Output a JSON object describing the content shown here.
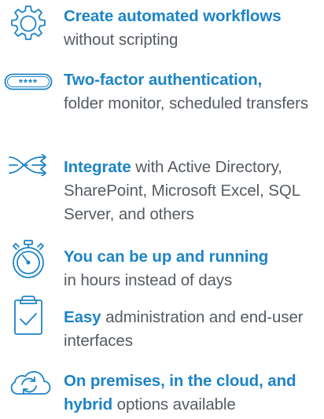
{
  "colors": {
    "accent": "#1d84c6",
    "body_text": "#555b62"
  },
  "features": [
    {
      "icon": "gear-icon",
      "highlight": "Create automated workflows",
      "rest": "without scripting"
    },
    {
      "icon": "password-field-icon",
      "password_mask": "****",
      "highlight": "Two-factor authentication,",
      "rest": "folder monitor, scheduled transfers"
    },
    {
      "icon": "shuffle-arrows-icon",
      "highlight": "Integrate",
      "rest": "with Active Directory, SharePoint, Microsoft Excel, SQL Server, and others"
    },
    {
      "icon": "stopwatch-icon",
      "highlight": "You can be up and running",
      "rest": "in hours instead of days"
    },
    {
      "icon": "clipboard-check-icon",
      "highlight": "Easy",
      "rest": "administration and end-user interfaces"
    },
    {
      "icon": "cloud-sync-icon",
      "highlight": "On premises, in the cloud, and hybrid",
      "rest": "options available"
    }
  ]
}
